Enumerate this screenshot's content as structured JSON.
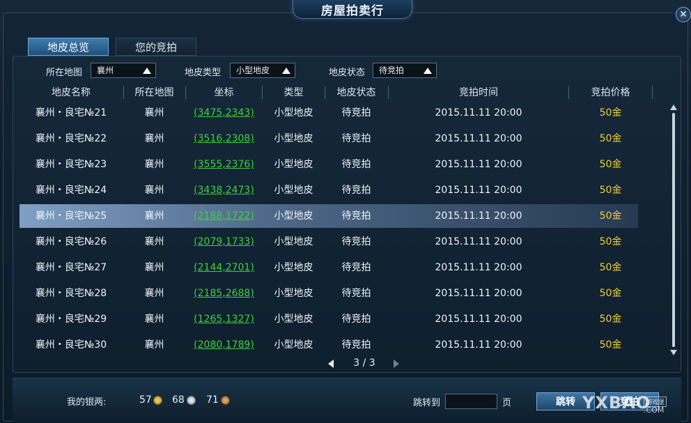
{
  "window": {
    "title": "房屋拍卖行",
    "close_glyph": "✕"
  },
  "tabs": [
    {
      "label": "地皮总览",
      "active": true
    },
    {
      "label": "您的竞拍",
      "active": false
    }
  ],
  "filters": {
    "map_label": "所在地图",
    "map_value": "襄州",
    "type_label": "地皮类型",
    "type_value": "小型地皮",
    "status_label": "地皮状态",
    "status_value": "待竞拍"
  },
  "table": {
    "headers": [
      "地皮名称",
      "所在地图",
      "坐标",
      "类型",
      "地皮状态",
      "竞拍时间",
      "竞拍价格"
    ],
    "selected_index": 4,
    "rows": [
      {
        "name": "襄州・良宅№21",
        "map": "襄州",
        "coord": "(3475,2343)",
        "type": "小型地皮",
        "status": "待竞拍",
        "time": "2015.11.11 20:00",
        "price": "50金"
      },
      {
        "name": "襄州・良宅№22",
        "map": "襄州",
        "coord": "(3516,2308)",
        "type": "小型地皮",
        "status": "待竞拍",
        "time": "2015.11.11 20:00",
        "price": "50金"
      },
      {
        "name": "襄州・良宅№23",
        "map": "襄州",
        "coord": "(3555,2376)",
        "type": "小型地皮",
        "status": "待竞拍",
        "time": "2015.11.11 20:00",
        "price": "50金"
      },
      {
        "name": "襄州・良宅№24",
        "map": "襄州",
        "coord": "(3438,2473)",
        "type": "小型地皮",
        "status": "待竞拍",
        "time": "2015.11.11 20:00",
        "price": "50金"
      },
      {
        "name": "襄州・良宅№25",
        "map": "襄州",
        "coord": "(2188,1722)",
        "type": "小型地皮",
        "status": "待竞拍",
        "time": "2015.11.11 20:00",
        "price": "50金"
      },
      {
        "name": "襄州・良宅№26",
        "map": "襄州",
        "coord": "(2079,1733)",
        "type": "小型地皮",
        "status": "待竞拍",
        "time": "2015.11.11 20:00",
        "price": "50金"
      },
      {
        "name": "襄州・良宅№27",
        "map": "襄州",
        "coord": "(2144,2701)",
        "type": "小型地皮",
        "status": "待竞拍",
        "time": "2015.11.11 20:00",
        "price": "50金"
      },
      {
        "name": "襄州・良宅№28",
        "map": "襄州",
        "coord": "(2185,2688)",
        "type": "小型地皮",
        "status": "待竞拍",
        "time": "2015.11.11 20:00",
        "price": "50金"
      },
      {
        "name": "襄州・良宅№29",
        "map": "襄州",
        "coord": "(1265,1327)",
        "type": "小型地皮",
        "status": "待竞拍",
        "time": "2015.11.11 20:00",
        "price": "50金"
      },
      {
        "name": "襄州・良宅№30",
        "map": "襄州",
        "coord": "(2080,1789)",
        "type": "小型地皮",
        "status": "待竞拍",
        "time": "2015.11.11 20:00",
        "price": "50金"
      }
    ]
  },
  "pager": {
    "text": "3 / 3"
  },
  "footer": {
    "money_label": "我的银两:",
    "gold": "57",
    "silver": "68",
    "copper": "71",
    "jump_label": "跳转到",
    "page_unit": "页",
    "jump_button": "跳转",
    "bid_button": "竞拍"
  },
  "watermark": {
    "text": "YXBAO",
    "sub": "游戏堡",
    "domain": ".COM"
  },
  "colors": {
    "coord": "#3fd23f",
    "price": "#f1d23a",
    "accent": "#3e7eb0"
  }
}
